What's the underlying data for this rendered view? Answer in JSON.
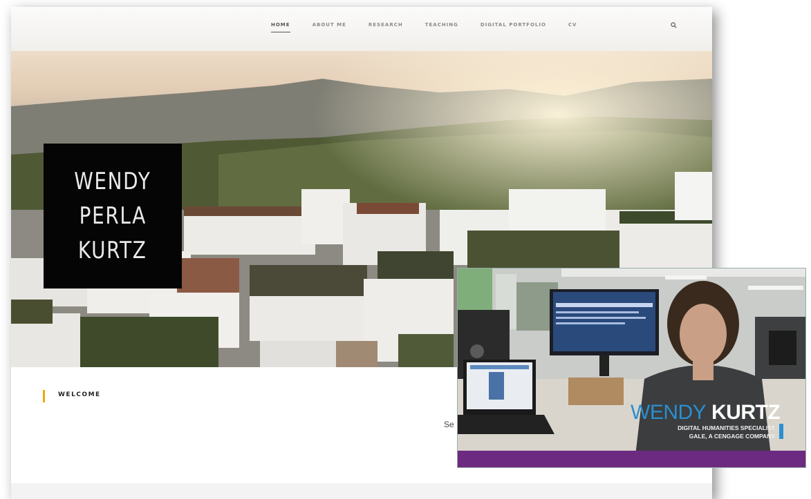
{
  "nav": {
    "items": [
      "HOME",
      "ABOUT ME",
      "RESEARCH",
      "TEACHING",
      "DIGITAL PORTFOLIO",
      "CV"
    ],
    "active": "HOME"
  },
  "hero": {
    "name_lines": [
      "WENDY",
      "PERLA",
      "KURTZ"
    ]
  },
  "welcome": {
    "label": "WELCOME",
    "partial_text": "Se"
  },
  "video": {
    "name_first": "WENDY",
    "name_last": "KURTZ",
    "title_line1": "DIGITAL HUMANITIES SPECIALIST",
    "title_line2": "GALE, A CENGAGE COMPANY",
    "colors": {
      "accent_blue": "#2b8fd0",
      "strip_purple": "#6c2a80"
    }
  },
  "colors": {
    "welcome_accent": "#f0a800"
  }
}
